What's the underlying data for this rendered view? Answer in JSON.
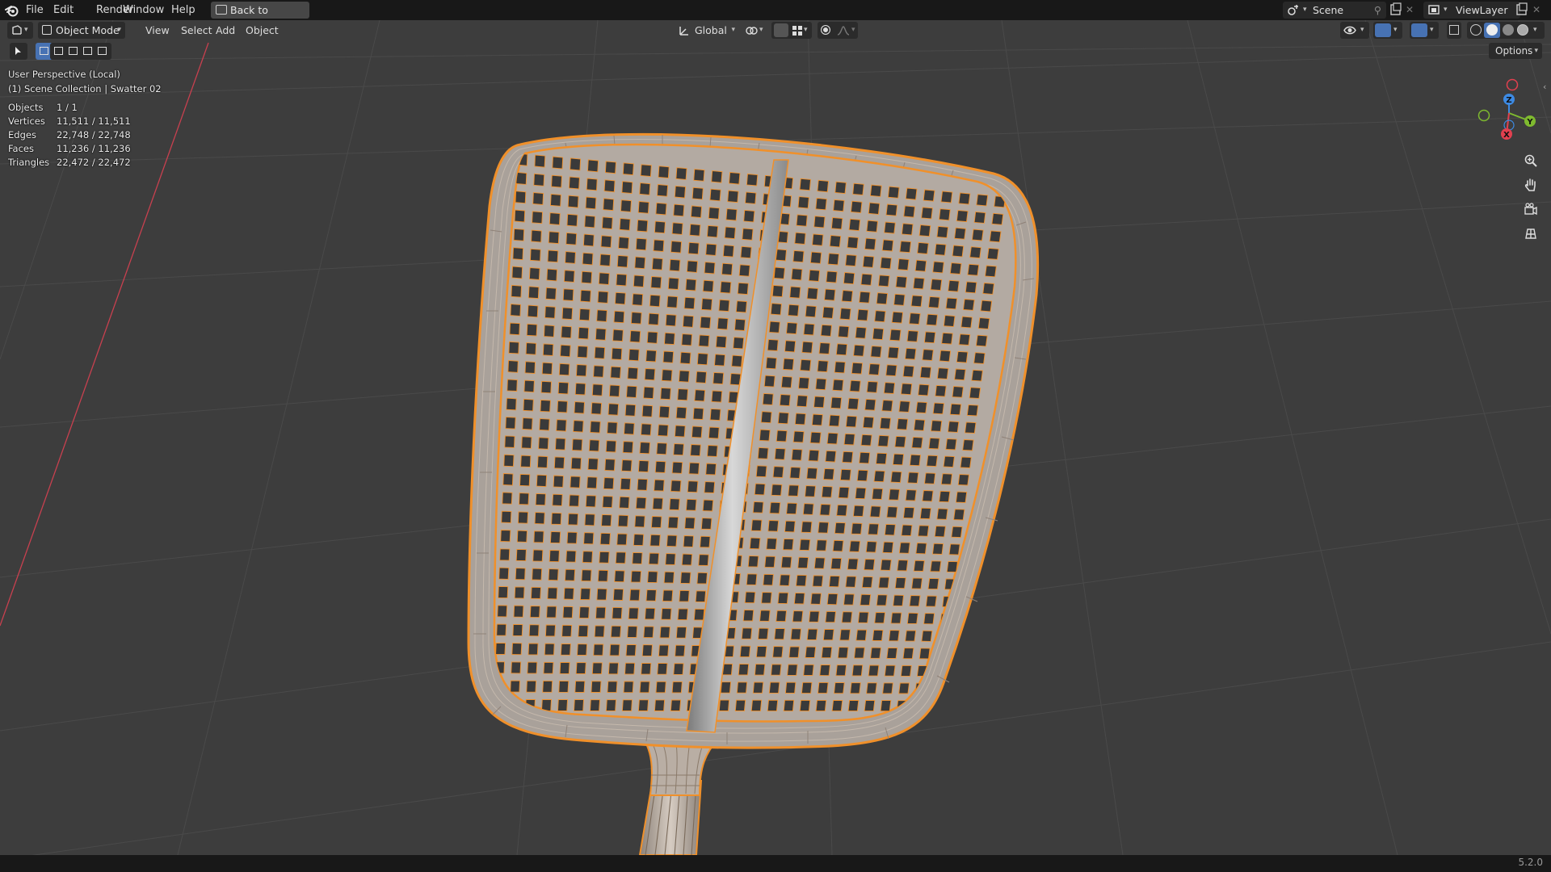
{
  "topbar": {
    "menus": [
      "File",
      "Edit",
      "Render",
      "Window",
      "Help"
    ],
    "back_label": "Back to Previous",
    "scene_label": "Scene",
    "viewlayer_label": "ViewLayer"
  },
  "viewport_header": {
    "mode_label": "Object Mode",
    "menus": [
      "View",
      "Select",
      "Add",
      "Object"
    ],
    "transform_orientation": "Global",
    "options_label": "Options"
  },
  "overlay": {
    "perspective": "User Perspective (Local)",
    "collection": "(1) Scene Collection | Swatter  02",
    "stats": [
      {
        "label": "Objects",
        "value": "1 / 1"
      },
      {
        "label": "Vertices",
        "value": "11,511 / 11,511"
      },
      {
        "label": "Edges",
        "value": "22,748 / 22,748"
      },
      {
        "label": "Faces",
        "value": "11,236 / 11,236"
      },
      {
        "label": "Triangles",
        "value": "22,472 / 22,472"
      }
    ]
  },
  "gizmo": {
    "axes": [
      "X",
      "Y",
      "Z"
    ],
    "colors": {
      "x": "#e2404f",
      "y": "#7fba2f",
      "z": "#3d8ae3"
    }
  },
  "nav_icons": [
    "zoom-icon",
    "pan-hand-icon",
    "camera-view-icon",
    "ortho-grid-icon"
  ],
  "object": {
    "name": "Swatter  02",
    "selection_color": "#f0902a",
    "mesh_color": "#aaaaaa"
  },
  "statusbar": {
    "version": "5.2.0"
  }
}
